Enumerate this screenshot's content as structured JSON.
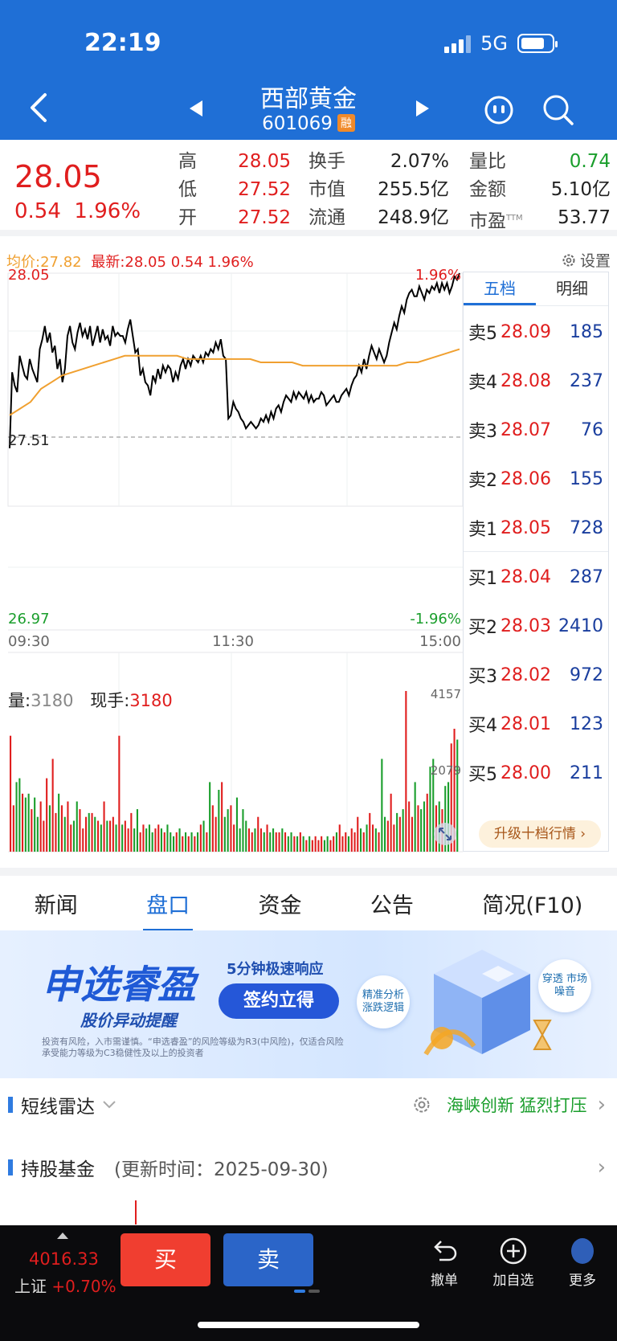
{
  "status": {
    "time": "22:19",
    "network": "5G"
  },
  "stock": {
    "name": "西部黄金",
    "code": "601069",
    "tag": "融",
    "price": "28.05",
    "change": "0.54",
    "change_pct": "1.96%"
  },
  "stats": {
    "high_label": "高",
    "high": "28.05",
    "low_label": "低",
    "low": "27.52",
    "open_label": "开",
    "open": "27.52",
    "turnover_label": "换手",
    "turnover": "2.07%",
    "mktcap_label": "市值",
    "mktcap": "255.5亿",
    "float_label": "流通",
    "float": "248.9亿",
    "volratio_label": "量比",
    "volratio": "0.74",
    "amount_label": "金额",
    "amount": "5.10亿",
    "pe_label": "市盈",
    "pe_sup": "TTM",
    "pe": "53.77"
  },
  "chart_header": {
    "avg_label": "均价:",
    "avg": "27.82",
    "last_label": "最新:",
    "last": "28.05",
    "last_chg": "0.54",
    "last_pct": "1.96%",
    "settings": "设置"
  },
  "chart_data": {
    "type": "line",
    "price_axis": {
      "top": "28.05",
      "mid": "27.51",
      "bottom": "26.97",
      "top_pct": "1.96%",
      "bottom_pct": "-1.96%"
    },
    "time_labels": [
      "09:30",
      "11:30",
      "15:00"
    ],
    "series": [
      {
        "name": "price",
        "color": "#000000",
        "values": [
          27.52,
          27.75,
          27.71,
          27.69,
          27.8,
          27.77,
          27.74,
          27.73,
          27.79,
          27.76,
          27.74,
          27.72,
          27.82,
          27.85,
          27.89,
          27.84,
          27.87,
          27.81,
          27.83,
          27.76,
          27.79,
          27.72,
          27.76,
          27.86,
          27.89,
          27.84,
          27.82,
          27.87,
          27.9,
          27.86,
          27.88,
          27.85,
          27.89,
          27.83,
          27.86,
          27.89,
          27.84,
          27.88,
          27.85,
          27.86,
          27.83,
          27.89,
          27.86,
          27.87,
          27.86,
          27.86,
          27.84,
          27.88,
          27.91,
          27.86,
          27.81,
          27.82,
          27.74,
          27.76,
          27.72,
          27.71,
          27.68,
          27.74,
          27.72,
          27.76,
          27.73,
          27.77,
          27.75,
          27.77,
          27.76,
          27.72,
          27.75,
          27.73,
          27.77,
          27.79,
          27.76,
          27.79,
          27.77,
          27.8,
          27.79,
          27.78,
          27.8,
          27.78,
          27.81,
          27.8,
          27.82,
          27.81,
          27.84,
          27.82,
          27.85,
          27.8,
          27.79,
          27.61,
          27.62,
          27.66,
          27.64,
          27.63,
          27.61,
          27.6,
          27.58,
          27.59,
          27.6,
          27.59,
          27.58,
          27.59,
          27.61,
          27.6,
          27.62,
          27.6,
          27.63,
          27.61,
          27.64,
          27.65,
          27.63,
          27.66,
          27.68,
          27.67,
          27.66,
          27.69,
          27.67,
          27.69,
          27.68,
          27.67,
          27.69,
          27.66,
          27.68,
          27.66,
          27.67,
          27.67,
          27.69,
          27.68,
          27.65,
          27.66,
          27.67,
          27.68,
          27.66,
          27.66,
          27.68,
          27.69,
          27.7,
          27.68,
          27.71,
          27.73,
          27.74,
          27.77,
          27.75,
          27.79,
          27.76,
          27.8,
          27.83,
          27.81,
          27.79,
          27.82,
          27.8,
          27.78,
          27.8,
          27.84,
          27.87,
          27.9,
          27.88,
          27.92,
          27.95,
          27.93,
          27.97,
          27.99,
          28.0,
          27.98,
          27.98,
          28.01,
          27.99,
          27.97,
          28.0,
          27.99,
          28.01,
          28.0,
          28.02,
          27.99,
          28.02,
          28.0,
          28.02,
          27.99,
          28.01,
          28.04,
          28.03,
          28.05
        ]
      },
      {
        "name": "avg",
        "color": "#f0a030",
        "values": [
          27.62,
          27.64,
          27.66,
          27.7,
          27.72,
          27.74,
          27.75,
          27.76,
          27.77,
          27.78,
          27.79,
          27.8,
          27.8,
          27.8,
          27.8,
          27.8,
          27.8,
          27.79,
          27.79,
          27.79,
          27.79,
          27.79,
          27.79,
          27.79,
          27.78,
          27.78,
          27.78,
          27.78,
          27.77,
          27.77,
          27.77,
          27.77,
          27.77,
          27.77,
          27.77,
          27.77,
          27.77,
          27.77,
          27.78,
          27.78,
          27.79,
          27.8,
          27.81,
          27.82
        ]
      }
    ],
    "volume": {
      "label": "量:",
      "value": "3180",
      "cur_label": "现手:",
      "cur_value": "3180",
      "max": "4157",
      "mid": "2079",
      "bars": [
        3000,
        1200,
        1800,
        1900,
        1500,
        1400,
        1500,
        1100,
        1400,
        900,
        1300,
        800,
        1900,
        1200,
        2400,
        1000,
        1500,
        1200,
        900,
        1300,
        700,
        800,
        1300,
        1100,
        600,
        900,
        1000,
        1000,
        900,
        800,
        700,
        1300,
        800,
        800,
        900,
        700,
        3000,
        700,
        800,
        600,
        1000,
        600,
        1100,
        500,
        700,
        600,
        700,
        500,
        600,
        700,
        600,
        500,
        700,
        500,
        400,
        500,
        600,
        400,
        500,
        400,
        500,
        400,
        500,
        700,
        800,
        500,
        1800,
        1200,
        900,
        1600,
        1800,
        900,
        1100,
        1200,
        700,
        1400,
        600,
        1100,
        800,
        600,
        500,
        600,
        900,
        600,
        500,
        700,
        500,
        600,
        500,
        500,
        600,
        500,
        400,
        500,
        400,
        400,
        500,
        400,
        300,
        400,
        300,
        400,
        300,
        400,
        300,
        400,
        300,
        400,
        500,
        700,
        400,
        500,
        400,
        600,
        500,
        900,
        600,
        500,
        700,
        1000,
        700,
        600,
        500,
        2400,
        900,
        800,
        1500,
        700,
        1000,
        900,
        1100,
        4157,
        1300,
        900,
        1800,
        1200,
        1100,
        1300,
        1500,
        2200,
        2400,
        1200,
        1300,
        1100,
        1700,
        1800,
        2800,
        3180,
        2900
      ]
    }
  },
  "order_book": {
    "tabs": [
      "五档",
      "明细"
    ],
    "asks": [
      {
        "label": "卖5",
        "price": "28.09",
        "vol": "185"
      },
      {
        "label": "卖4",
        "price": "28.08",
        "vol": "237"
      },
      {
        "label": "卖3",
        "price": "28.07",
        "vol": "76"
      },
      {
        "label": "卖2",
        "price": "28.06",
        "vol": "155"
      },
      {
        "label": "卖1",
        "price": "28.05",
        "vol": "728"
      }
    ],
    "bids": [
      {
        "label": "买1",
        "price": "28.04",
        "vol": "287"
      },
      {
        "label": "买2",
        "price": "28.03",
        "vol": "2410"
      },
      {
        "label": "买3",
        "price": "28.02",
        "vol": "972"
      },
      {
        "label": "买4",
        "price": "28.01",
        "vol": "123"
      },
      {
        "label": "买5",
        "price": "28.00",
        "vol": "211"
      }
    ],
    "upgrade": "升级十档行情 ›"
  },
  "tabs": [
    "新闻",
    "盘口",
    "资金",
    "公告",
    "简况(F10)"
  ],
  "banner": {
    "title": "申选睿盈",
    "subtitle": "股价异动提醒",
    "response": "5分钟极速响应",
    "button": "签约立得",
    "fine": "投资有风险，入市需谨慎。“申选睿盈”的风险等级为R3(中风险)，仅适合风险承受能力等级为C3稳健性及以上的投资者",
    "bubble1": "精准分析 涨跌逻辑",
    "bubble2": "穿透 市场噪音"
  },
  "radar": {
    "label": "短线雷达",
    "tags": "海峡创新 猛烈打压"
  },
  "fund": {
    "label": "持股基金",
    "updated": "(更新时间：2025-09-30)"
  },
  "bottom": {
    "index_value": "4016.33",
    "index_name": "上证",
    "index_chg": "+0.70%",
    "buy": "买",
    "sell": "卖",
    "cancel": "撤单",
    "add_fav": "加自选",
    "more": "更多"
  },
  "colors": {
    "header": "#1f6fd6",
    "up": "#e01e1e",
    "down": "#1a9e2c",
    "avg_line": "#f0a030"
  }
}
